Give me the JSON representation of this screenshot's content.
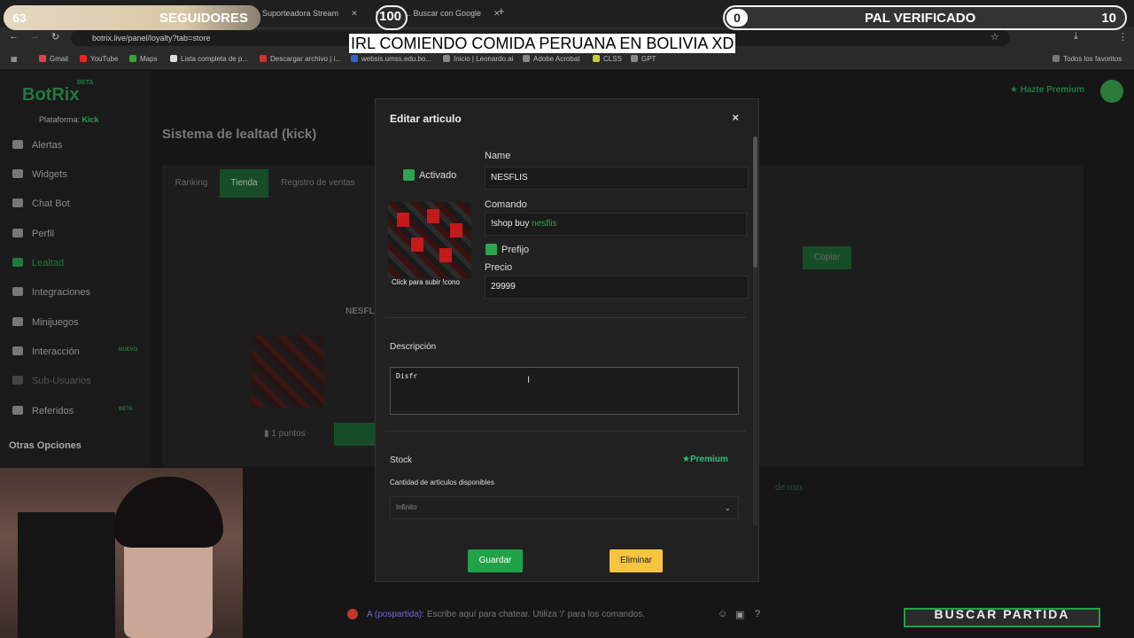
{
  "browser": {
    "tabs": [
      {
        "label": "Suporteadora Stream"
      },
      {
        "label": "traducto... Buscar con Google"
      }
    ],
    "url": "botrix.live/panel/loyalty?tab=store",
    "bookmarks": [
      "Gmail",
      "YouTube",
      "Maps",
      "Lista completa de p...",
      "Descargar archivo | i...",
      "websis.umss.edu.bo...",
      "Inicio | Leonardo.ai",
      "Adobe Acrobat",
      "CLSS",
      "GPT"
    ],
    "bookmarks_folder": "Todos los favoritos"
  },
  "overlays": {
    "left_num": "63",
    "left_label": "SEGUIDORES",
    "left_goal": "100",
    "right_num": "0",
    "right_label": "PAL VERIFICADO",
    "right_goal": "10",
    "stream_title": "IRL COMIENDO COMIDA PERUANA EN BOLIVIA XD",
    "game_button": "BUSCAR PARTIDA"
  },
  "sidebar": {
    "logo": "BotRix",
    "beta": "BETA",
    "platform_label": "Plataforma:",
    "platform_value": "Kick",
    "items": [
      {
        "label": "Alertas"
      },
      {
        "label": "Widgets"
      },
      {
        "label": "Chat Bot"
      },
      {
        "label": "Perfil"
      },
      {
        "label": "Lealtad"
      },
      {
        "label": "Integraciones"
      },
      {
        "label": "Minijuegos"
      },
      {
        "label": "Interacción",
        "tag": "NUEVO"
      },
      {
        "label": "Sub-Usuarios"
      },
      {
        "label": "Referidos",
        "tag": "BETA"
      }
    ],
    "section": "Otras Opciones"
  },
  "header": {
    "premium": "Hazte Premium"
  },
  "page": {
    "title": "Sistema de lealtad (kick)",
    "tabs": [
      "Ranking",
      "Tienda",
      "Registro de ventas"
    ],
    "copy_button": "Copiar",
    "item_name": "NESFLIS",
    "price_label": "1 puntos",
    "footnote": "de uso."
  },
  "modal": {
    "title": "Editar articulo",
    "close": "×",
    "activado": "Activado",
    "name_label": "Name",
    "name_value": "NESFLIS",
    "command_label": "Comando",
    "command_prefix": "!shop buy",
    "command_value": "nesflis",
    "prefijo": "Prefijo",
    "price_label": "Precio",
    "price_value": "29999",
    "upload_hint": "Click para subir !cono",
    "desc_label": "Descripción",
    "desc_value": "Disfr",
    "stock_label": "Stock",
    "premium": "Premium",
    "stock_sub": "Cantidad de artículos disponibles",
    "stock_value": "Infinito",
    "save": "Guardar",
    "delete": "Eliminar"
  },
  "chat": {
    "user": "A (pospartida):",
    "placeholder": "Escribe aquí para chatear. Utiliza '/' para los comandos."
  }
}
